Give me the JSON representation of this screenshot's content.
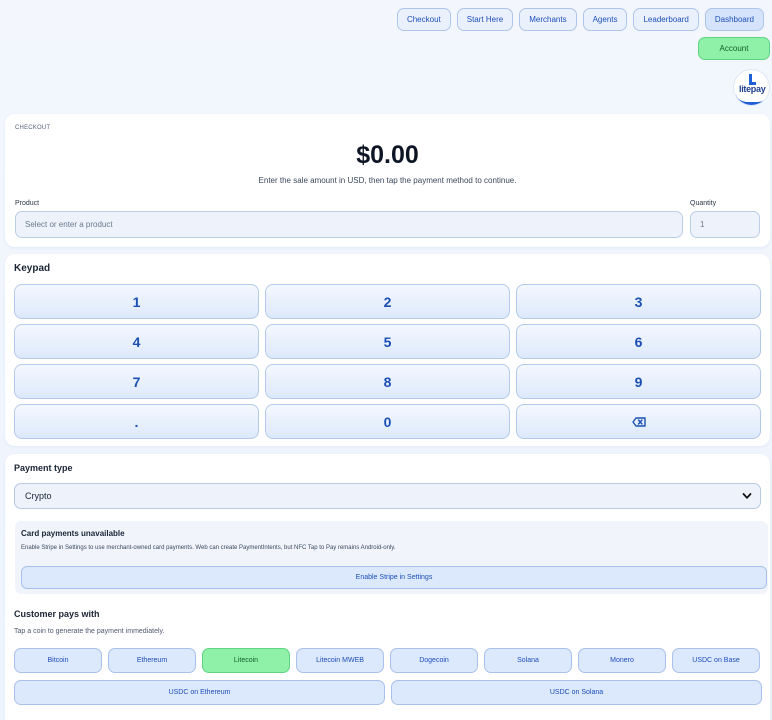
{
  "nav": {
    "items": [
      "Checkout",
      "Start Here",
      "Merchants",
      "Agents",
      "Leaderboard",
      "Dashboard"
    ],
    "account_label": "Account",
    "logo_text": "litepay"
  },
  "checkout": {
    "eyebrow": "CHECKOUT",
    "amount": "$0.00",
    "hint": "Enter the sale amount in USD, then tap the payment method to continue.",
    "product_label": "Product",
    "product_placeholder": "Select or enter a product",
    "quantity_label": "Quantity",
    "quantity_value": "1"
  },
  "keypad": {
    "title": "Keypad",
    "keys": [
      "1",
      "2",
      "3",
      "4",
      "5",
      "6",
      "7",
      "8",
      "9",
      ".",
      "0",
      "⌫"
    ]
  },
  "payment": {
    "title": "Payment type",
    "selected": "Crypto",
    "notice_title": "Card payments unavailable",
    "notice_text": "Enable Stripe in Settings to use merchant-owned card payments. Web can create PaymentIntents, but NFC Tap to Pay remains Android-only.",
    "notice_button": "Enable Stripe in Settings",
    "customer_title": "Customer pays with",
    "customer_hint": "Tap a coin to generate the payment immediately.",
    "coins": [
      "Bitcoin",
      "Ethereum",
      "Litecoin",
      "Litecoin MWEB",
      "Dogecoin",
      "Solana",
      "Monero",
      "USDC on Base"
    ],
    "coins_row2": [
      "USDC on Ethereum",
      "USDC on Solana"
    ],
    "selected_coin": "Litecoin"
  },
  "colors": {
    "accent": "#1c4eb8",
    "success": "#8ff0a8"
  }
}
